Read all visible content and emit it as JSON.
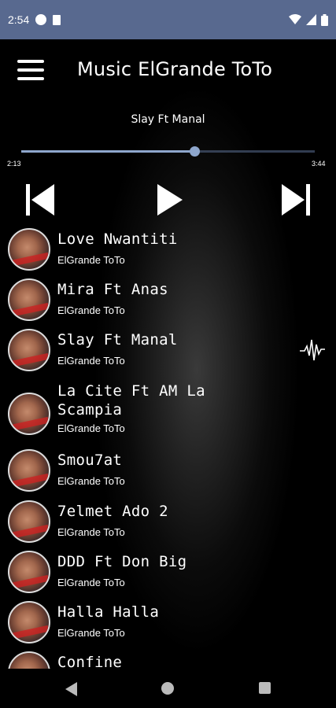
{
  "status_bar": {
    "time": "2:54",
    "icons": [
      "lock-circle-icon",
      "sd-card-icon",
      "wifi-icon",
      "signal-icon",
      "battery-icon"
    ]
  },
  "toolbar": {
    "menu_icon": "hamburger-menu-icon",
    "title": "Music ElGrande ToTo"
  },
  "player": {
    "now_playing": "Slay Ft Manal",
    "elapsed": "2:13",
    "total": "3:44",
    "progress": 0.59,
    "controls": [
      "skip-previous-icon",
      "play-icon",
      "skip-next-icon"
    ]
  },
  "songs": [
    {
      "title": "Love Nwantiti",
      "artist": "ElGrande ToTo",
      "playing": false
    },
    {
      "title": "Mira Ft Anas",
      "artist": "ElGrande ToTo",
      "playing": false
    },
    {
      "title": "Slay Ft Manal",
      "artist": "ElGrande ToTo",
      "playing": true,
      "indicator_icon": "audio-wave-icon"
    },
    {
      "title": "La Cite Ft AM La\nScampia",
      "artist": "ElGrande ToTo",
      "playing": false
    },
    {
      "title": "Smou7at",
      "artist": "ElGrande ToTo",
      "playing": false
    },
    {
      "title": "7elmet Ado 2",
      "artist": "ElGrande ToTo",
      "playing": false
    },
    {
      "title": "DDD Ft Don Big",
      "artist": "ElGrande ToTo",
      "playing": false
    },
    {
      "title": "Halla Halla",
      "artist": "ElGrande ToTo",
      "playing": false
    },
    {
      "title": "Confine",
      "artist": "",
      "playing": false
    }
  ],
  "nav_bar": {
    "icons": [
      "back-icon",
      "home-icon",
      "recents-icon"
    ]
  },
  "colors": {
    "status_bar": "#58698f",
    "accent": "#8ea6cc",
    "background": "#000000",
    "text": "#ffffff"
  }
}
